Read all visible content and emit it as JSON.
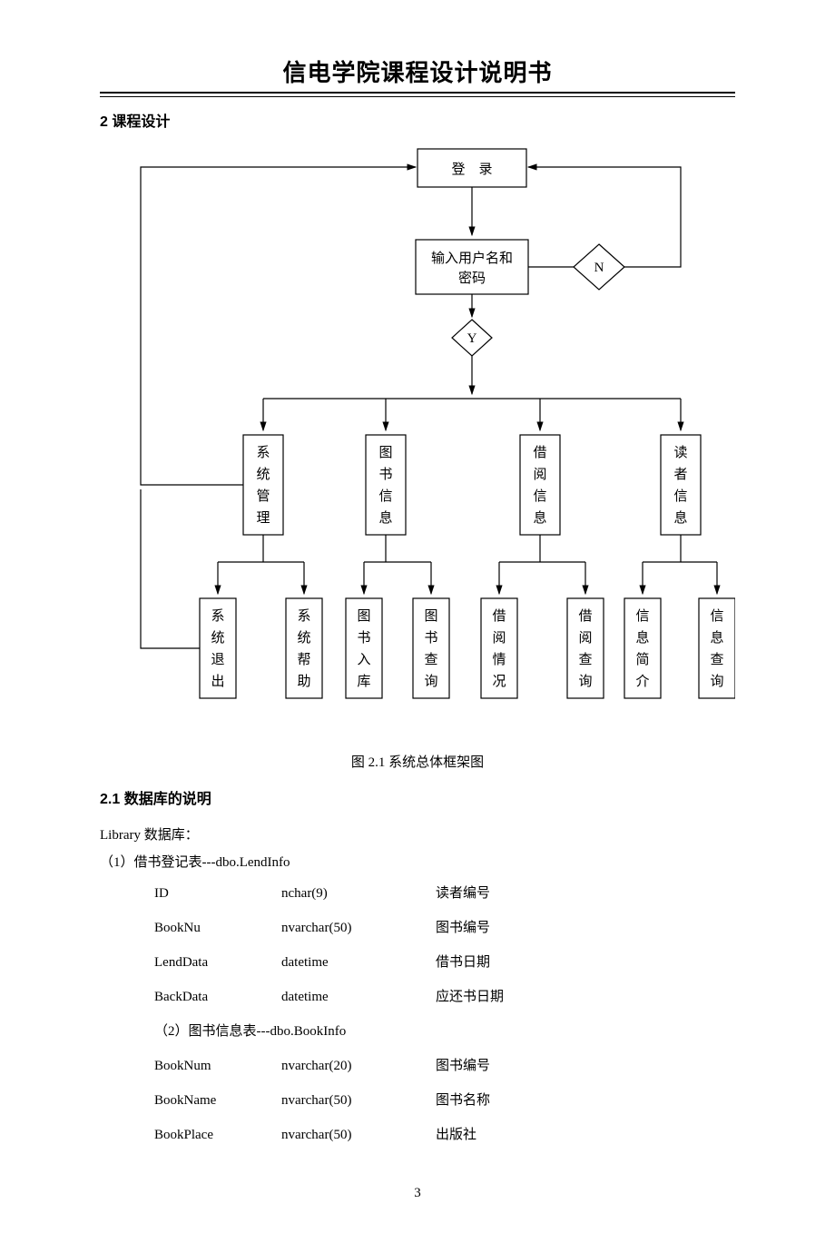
{
  "header": {
    "title": "信电学院课程设计说明书"
  },
  "section2": {
    "heading": "2 课程设计"
  },
  "figure": {
    "caption": "图 2.1  系统总体框架图"
  },
  "section21": {
    "heading": "2.1 数据库的说明"
  },
  "db_intro": "Library 数据库：",
  "table1_title": "（1）借书登记表---dbo.LendInfo",
  "table1": {
    "rows": [
      {
        "field": "ID",
        "type": "nchar(9)",
        "desc": "读者编号"
      },
      {
        "field": "BookNu",
        "type": "nvarchar(50)",
        "desc": "图书编号"
      },
      {
        "field": "LendData",
        "type": "datetime",
        "desc": "借书日期"
      },
      {
        "field": "BackData",
        "type": "datetime",
        "desc": "应还书日期"
      }
    ]
  },
  "table2_title": "（2）图书信息表---dbo.BookInfo",
  "table2": {
    "rows": [
      {
        "field": "BookNum",
        "type": "nvarchar(20)",
        "desc": "图书编号"
      },
      {
        "field": "BookName",
        "type": "nvarchar(50)",
        "desc": "图书名称"
      },
      {
        "field": "BookPlace",
        "type": "nvarchar(50)",
        "desc": "出版社"
      }
    ]
  },
  "page_number": "3",
  "chart_data": {
    "type": "flowchart",
    "title": "系统总体框架图",
    "nodes": {
      "login": {
        "label": "登  录",
        "shape": "rect"
      },
      "input": {
        "label": "输入用户名和\n密码",
        "shape": "rect"
      },
      "decideY": {
        "label": "Y",
        "shape": "diamond"
      },
      "decideN": {
        "label": "N",
        "shape": "diamond"
      },
      "sys_mgmt": {
        "label": "系统管理",
        "shape": "rect-vertical"
      },
      "book_info": {
        "label": "图书信息",
        "shape": "rect-vertical"
      },
      "lend_info": {
        "label": "借阅信息",
        "shape": "rect-vertical"
      },
      "reader_info": {
        "label": "读者信息",
        "shape": "rect-vertical"
      },
      "sys_exit": {
        "label": "系统退出",
        "shape": "rect-vertical"
      },
      "sys_help": {
        "label": "系统帮助",
        "shape": "rect-vertical"
      },
      "book_in": {
        "label": "图书入库",
        "shape": "rect-vertical"
      },
      "book_query": {
        "label": "图书查询",
        "shape": "rect-vertical"
      },
      "lend_status": {
        "label": "借阅情况",
        "shape": "rect-vertical"
      },
      "lend_query": {
        "label": "借阅查询",
        "shape": "rect-vertical"
      },
      "info_brief": {
        "label": "信息简介",
        "shape": "rect-vertical"
      },
      "info_query": {
        "label": "信息查询",
        "shape": "rect-vertical"
      }
    },
    "edges": [
      [
        "login",
        "input"
      ],
      [
        "input",
        "decideY"
      ],
      [
        "input",
        "decideN"
      ],
      [
        "decideN",
        "login"
      ],
      [
        "decideY",
        "sys_mgmt"
      ],
      [
        "decideY",
        "book_info"
      ],
      [
        "decideY",
        "lend_info"
      ],
      [
        "decideY",
        "reader_info"
      ],
      [
        "sys_mgmt",
        "sys_exit"
      ],
      [
        "sys_mgmt",
        "sys_help"
      ],
      [
        "book_info",
        "book_in"
      ],
      [
        "book_info",
        "book_query"
      ],
      [
        "lend_info",
        "lend_status"
      ],
      [
        "lend_info",
        "lend_query"
      ],
      [
        "reader_info",
        "info_brief"
      ],
      [
        "reader_info",
        "info_query"
      ],
      [
        "sys_mgmt",
        "login"
      ],
      [
        "sys_exit",
        "login_feedback"
      ]
    ]
  }
}
